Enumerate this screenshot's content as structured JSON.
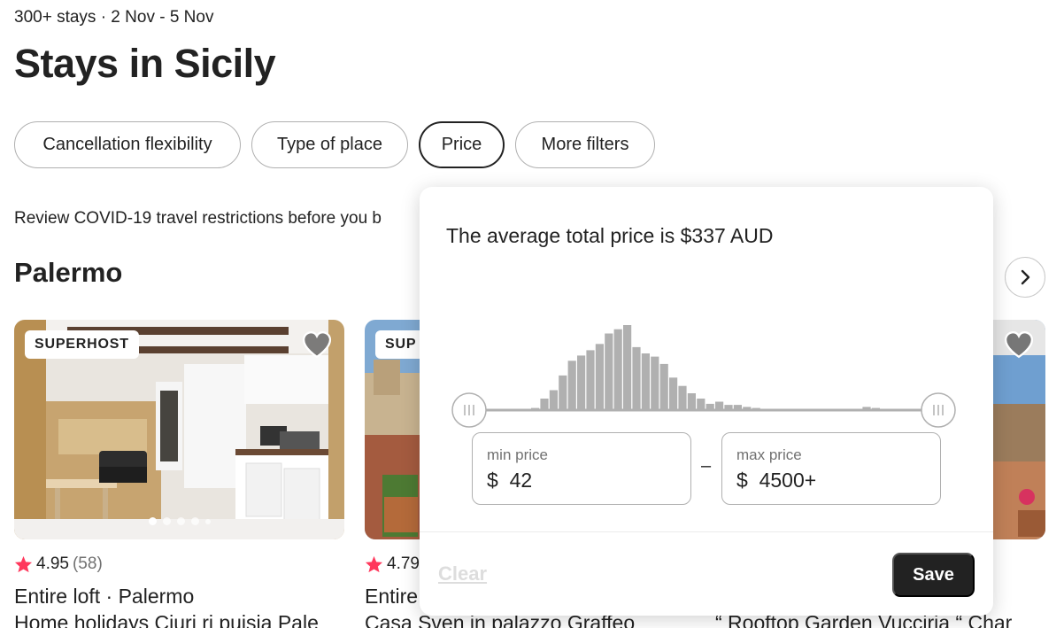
{
  "header": {
    "subtitle": "300+ stays · 2 Nov - 5 Nov",
    "title": "Stays in Sicily"
  },
  "filters": [
    {
      "label": "Cancellation flexibility",
      "active": false
    },
    {
      "label": "Type of place",
      "active": false
    },
    {
      "label": "Price",
      "active": true
    },
    {
      "label": "More filters",
      "active": false
    }
  ],
  "covid_notice": "Review COVID-19 travel restrictions before you b",
  "section": {
    "title": "Palermo"
  },
  "listings": [
    {
      "badge": "SUPERHOST",
      "rating": "4.95",
      "reviews": "(58)",
      "type": "Entire loft · Palermo",
      "name": "Home holidays Ciuri ri puisia Pale"
    },
    {
      "badge": "SUP",
      "rating": "4.79",
      "reviews": "",
      "type": "Entire",
      "name": "Casa Sven in palazzo Graffeo"
    },
    {
      "badge": "",
      "rating": "",
      "reviews": "",
      "type": "",
      "name": "“ Rooftop Garden Vucciria “ Char"
    }
  ],
  "price_popover": {
    "average_text": "The average total price is $337 AUD",
    "histogram": [
      2,
      11,
      19,
      33,
      47,
      52,
      57,
      63,
      73,
      77,
      81,
      60,
      54,
      51,
      44,
      31,
      23,
      16,
      11,
      6,
      8,
      5,
      5,
      3,
      2,
      1,
      0,
      0,
      0,
      0,
      0,
      0,
      0,
      0,
      0,
      0,
      3,
      2,
      1
    ],
    "slider_low": 0,
    "slider_high": 1,
    "min": {
      "label": "min price",
      "currency": "$",
      "value": "42"
    },
    "separator": "–",
    "max": {
      "label": "max price",
      "currency": "$",
      "value": "4500+"
    },
    "clear_label": "Clear",
    "save_label": "Save"
  },
  "colors": {
    "text": "#222222",
    "muted": "#717171",
    "star": "#ff385c",
    "histogram_bar": "#b0b0b0",
    "track": "#b0b0b0",
    "save_bg": "#222222",
    "clear_disabled": "#dddddd"
  },
  "icons": {
    "next": "chevron-right-icon",
    "favorite": "heart-icon",
    "star": "star-icon",
    "slider_handle": "grip-lines-icon"
  }
}
